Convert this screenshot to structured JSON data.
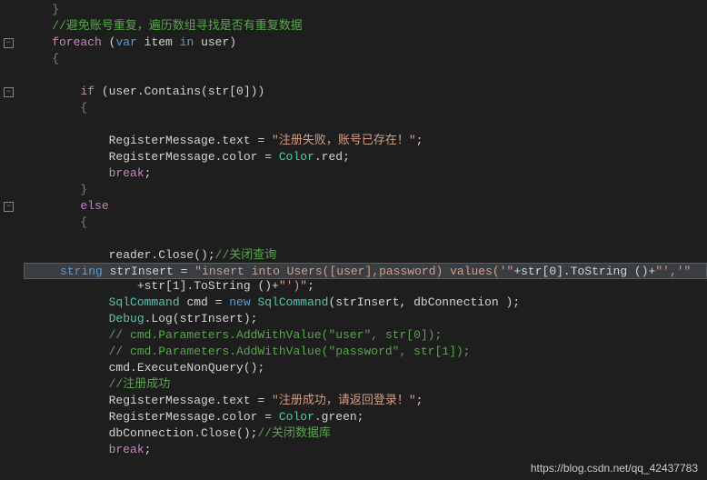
{
  "code": {
    "l1": "    }",
    "l2": "    //避免账号重复，遍历数组寻找是否有重复数据",
    "l3_foreach": "    foreach",
    "l3_rest": " (var item in user)",
    "l4": "    {",
    "l6_if": "        if",
    "l6_rest": " (user.Contains(str[0]))",
    "l7": "        {",
    "l9a": "            RegisterMessage.text = ",
    "l9b": "\"注册失败，账号已存在！\"",
    "l9c": ";",
    "l10a": "            RegisterMessage.color = ",
    "l10b": "Color",
    "l10c": ".red;",
    "l11": "            break",
    "l11b": ";",
    "l12": "        }",
    "l13": "        else",
    "l14": "        {",
    "l16a": "            reader.Close();",
    "l16b": "//关闭查询",
    "l17a": "     ",
    "l17b": "string",
    "l17c": " strInsert = ",
    "l17d": "\"insert into Users([user],password) values('\"",
    "l17e": "+str[0].ToString ()+",
    "l17f": "\"','\"",
    "l18a": "                +str[1].ToString ()+",
    "l18b": "\"')\"",
    "l18c": ";",
    "l19a": "            SqlCommand",
    "l19b": " cmd = ",
    "l19c": "new",
    "l19d": " SqlCommand",
    "l19e": "(strInsert, dbConnection );",
    "l20a": "            Debug",
    "l20b": ".Log(strInsert);",
    "l21": "            // cmd.Parameters.AddWithValue(\"user\", str[0]);",
    "l22": "            // cmd.Parameters.AddWithValue(\"password\", str[1]);",
    "l23": "            cmd.ExecuteNonQuery();",
    "l24": "            //注册成功",
    "l25a": "            RegisterMessage.text = ",
    "l25b": "\"注册成功，请返回登录！\"",
    "l25c": ";",
    "l26a": "            RegisterMessage.color = ",
    "l26b": "Color",
    "l26c": ".green;",
    "l27a": "            dbConnection.Close();",
    "l27b": "//关闭数据库",
    "l28a": "            break",
    "l28b": ";"
  },
  "watermark": "https://blog.csdn.net/qq_42437783"
}
